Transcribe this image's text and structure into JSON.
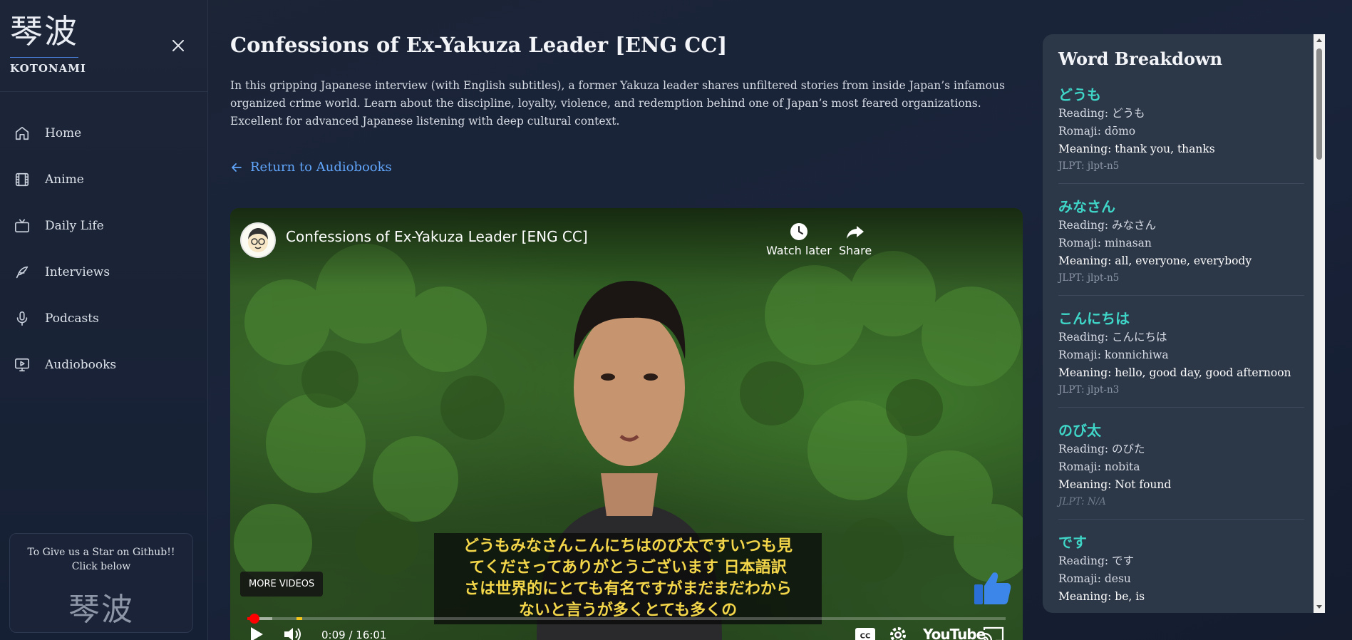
{
  "sidebar": {
    "brand_kanji": "琴波",
    "brand_name": "KOTONAMI",
    "items": [
      {
        "label": "Home",
        "icon": "home-icon"
      },
      {
        "label": "Anime",
        "icon": "film-icon"
      },
      {
        "label": "Daily Life",
        "icon": "tv-icon"
      },
      {
        "label": "Interviews",
        "icon": "microphone-feather-icon"
      },
      {
        "label": "Podcasts",
        "icon": "microphone-icon"
      },
      {
        "label": "Audiobooks",
        "icon": "monitor-play-icon"
      }
    ],
    "star_card": {
      "line1": "To Give us a Star on Github!!",
      "line2": "Click below",
      "kanji": "琴波"
    }
  },
  "main": {
    "title": "Confessions of Ex-Yakuza Leader [ENG CC]",
    "description": "In this gripping Japanese interview (with English subtitles), a former Yakuza leader shares unfiltered stories from inside Japan’s infamous organized crime world. Learn about the discipline, loyalty, violence, and redemption behind one of Japan’s most feared organizations. Excellent for advanced Japanese listening with deep cultural context.",
    "back_link": "Return to Audiobooks"
  },
  "video": {
    "title": "Confessions of Ex-Yakuza Leader [ENG CC]",
    "watch_later": "Watch later",
    "share": "Share",
    "captions": [
      "どうもみなさんこんにちはのび太ですいつも見",
      "てくださってありがとうございます 日本語訳",
      "さは世界的にとても有名ですがまだまだわから",
      "ないと言うが多くとても多くの"
    ],
    "more_videos": "MORE VIDEOS",
    "time": "0:09 / 16:01",
    "logo": "YouTube",
    "progress_fraction": 0.0094,
    "buffer_fraction": 0.033
  },
  "panel": {
    "title": "Word Breakdown",
    "words": [
      {
        "term": "どうも",
        "reading": "Reading: どうも",
        "romaji": "Romaji: dōmo",
        "meaning": "Meaning: thank you, thanks",
        "jlpt": "JLPT: jlpt-n5",
        "na": false
      },
      {
        "term": "みなさん",
        "reading": "Reading: みなさん",
        "romaji": "Romaji: minasan",
        "meaning": "Meaning: all, everyone, everybody",
        "jlpt": "JLPT: jlpt-n5",
        "na": false
      },
      {
        "term": "こんにちは",
        "reading": "Reading: こんにちは",
        "romaji": "Romaji: konnichiwa",
        "meaning": "Meaning: hello, good day, good afternoon",
        "jlpt": "JLPT: jlpt-n3",
        "na": false
      },
      {
        "term": "のび太",
        "reading": "Reading: のびた",
        "romaji": "Romaji: nobita",
        "meaning": "Meaning: Not found",
        "jlpt": "JLPT: N/A",
        "na": true
      },
      {
        "term": "です",
        "reading": "Reading: です",
        "romaji": "Romaji: desu",
        "meaning": "Meaning: be, is",
        "jlpt": "",
        "na": false
      }
    ]
  },
  "colors": {
    "accent_link": "#60a5fa",
    "word_term": "#3fd6c8",
    "caption": "#f4d64a",
    "progress": "#ff0000"
  }
}
